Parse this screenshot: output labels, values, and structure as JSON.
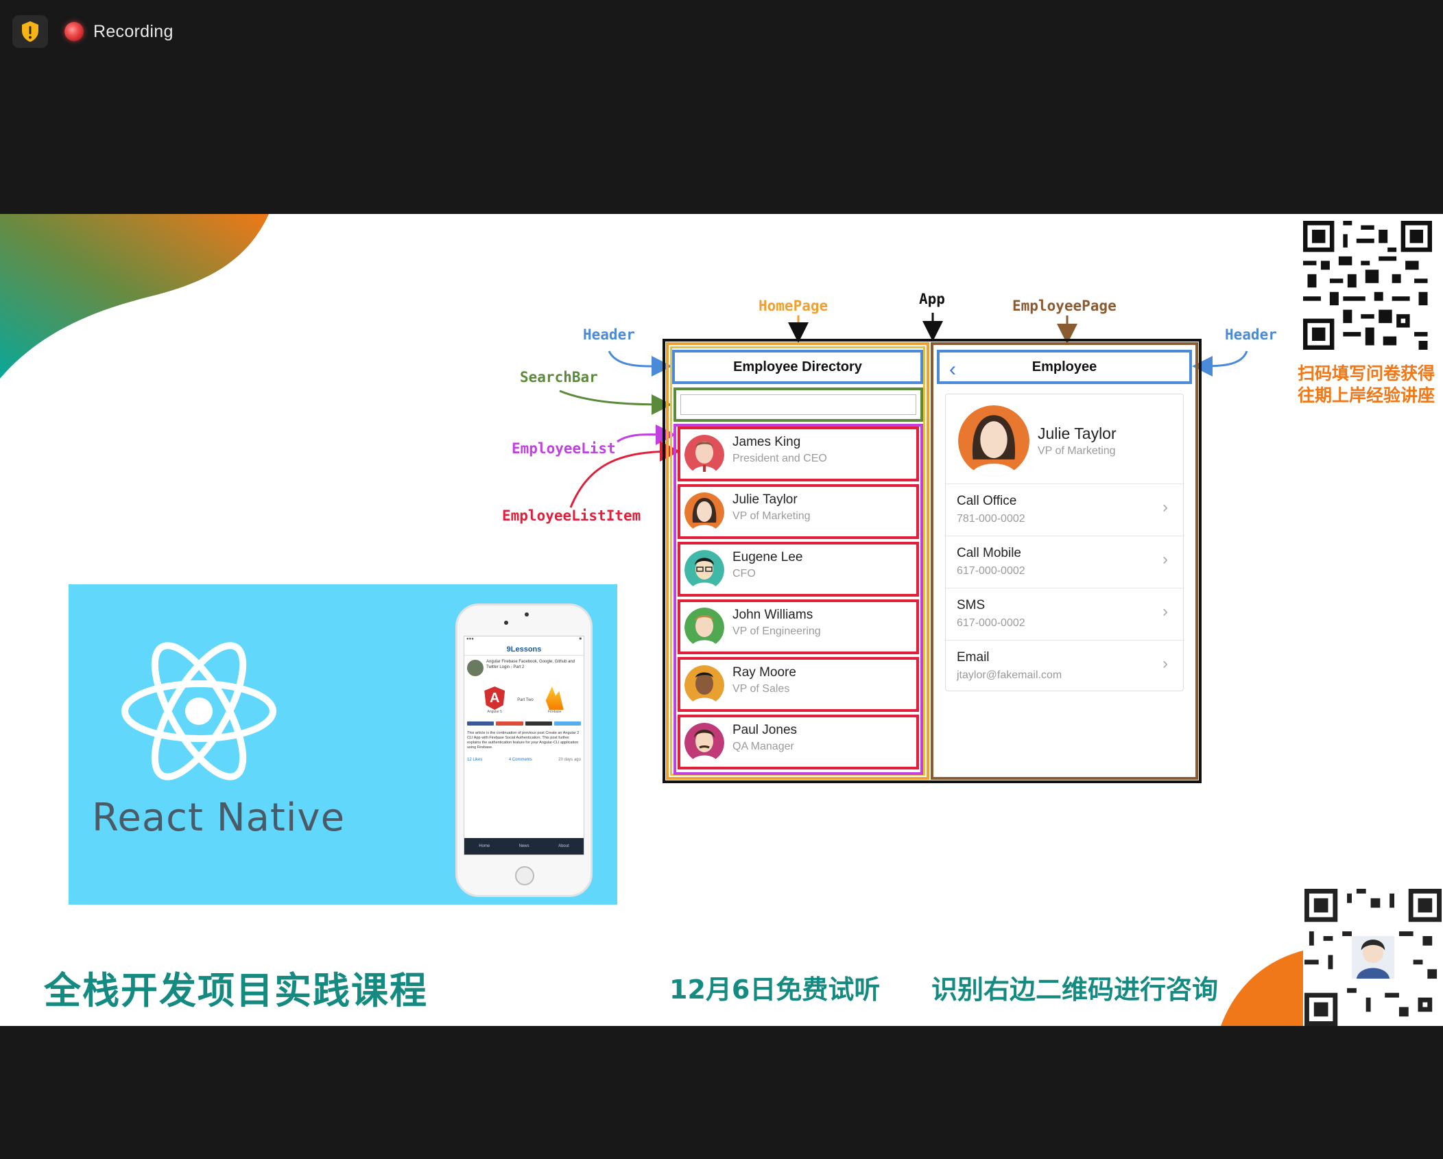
{
  "recorder": {
    "label": "Recording"
  },
  "slide": {
    "react_native_label": "React Native",
    "course_title": "全栈开发项目实践课程",
    "trial_text": "12月6日免费试听",
    "consult_text": "识别右边二维码进行咨询",
    "qr_caption_line1": "扫码填写问卷获得",
    "qr_caption_line2": "往期上岸经验讲座"
  },
  "phone_mock": {
    "brand": "9Lessons",
    "post_title": "Angular Firebase Facebook, Google, Github and Twitter Login - Part 2",
    "part_label": "Part Two",
    "left_logo": "Angular 5",
    "right_logo": "Firebase",
    "body": "This article is the continuation of previous post Create an Angular 2 CLI App with Firebase Social Authentication. This post further explains the authentication feature for your Angular-CLI application using Firebase.",
    "likes": "12 Likes",
    "comments": "4 Comments",
    "age": "20 days ago",
    "tabs": [
      "Home",
      "News",
      "About"
    ]
  },
  "diagram": {
    "annotations": {
      "homepage": "HomePage",
      "app": "App",
      "employeepage": "EmployeePage",
      "header_left": "Header",
      "header_right": "Header",
      "searchbar": "SearchBar",
      "employeelist": "EmployeeList",
      "employeelistitem": "EmployeeListItem"
    },
    "home_header": "Employee Directory",
    "employees": [
      {
        "name": "James King",
        "title": "President and CEO"
      },
      {
        "name": "Julie Taylor",
        "title": "VP of Marketing"
      },
      {
        "name": "Eugene Lee",
        "title": "CFO"
      },
      {
        "name": "John Williams",
        "title": "VP of Engineering"
      },
      {
        "name": "Ray Moore",
        "title": "VP of Sales"
      },
      {
        "name": "Paul Jones",
        "title": "QA Manager"
      }
    ],
    "employee_header": "Employee",
    "selected": {
      "name": "Julie Taylor",
      "title": "VP of Marketing"
    },
    "actions": [
      {
        "label": "Call Office",
        "value": "781-000-0002"
      },
      {
        "label": "Call Mobile",
        "value": "617-000-0002"
      },
      {
        "label": "SMS",
        "value": "617-000-0002"
      },
      {
        "label": "Email",
        "value": "jtaylor@fakemail.com"
      }
    ]
  },
  "colors": {
    "teal": "#148a80",
    "orange": "#f07818",
    "react_blue": "#61d8fb",
    "header_blue": "#4a8ad8",
    "list_purple": "#c040e0",
    "item_red": "#e0203a",
    "search_green": "#5a8a3a",
    "homepage_orange": "#f0a030",
    "employeepage_brown": "#8a5a30"
  }
}
